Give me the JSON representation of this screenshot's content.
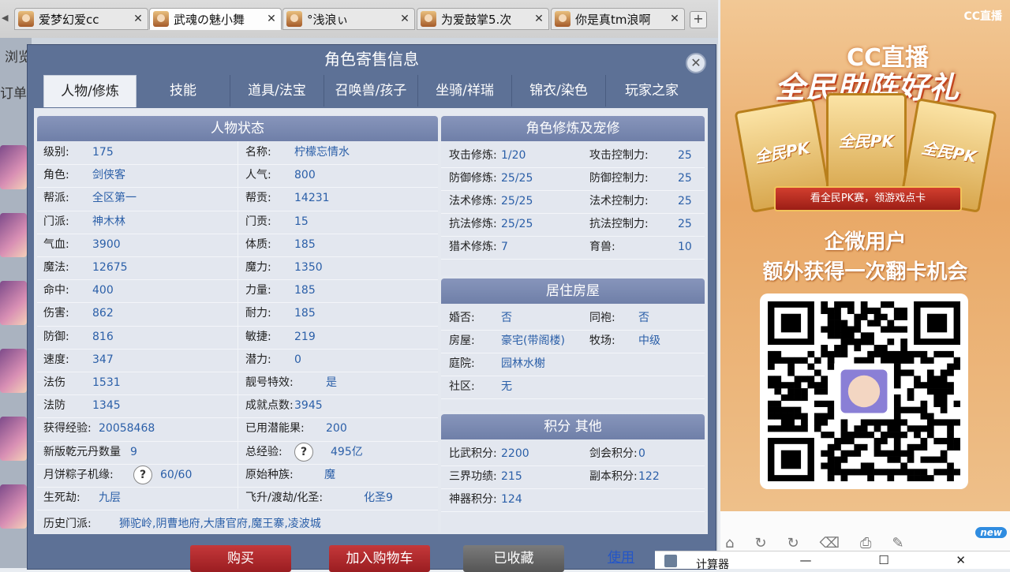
{
  "browser": {
    "tabs": [
      {
        "title": "爱梦幻爱cc",
        "close": "✕"
      },
      {
        "title": "武魂の魅小舞",
        "close": "✕"
      },
      {
        "title": "°浅浪ぃ",
        "close": "✕"
      },
      {
        "title": "为爱鼓掌5.次",
        "close": "✕"
      },
      {
        "title": "你是真tm浪啊",
        "close": "✕"
      }
    ],
    "add_tab": "+",
    "behind_text_1": "浏览",
    "behind_text_2": "订单"
  },
  "dialog": {
    "title": "角色寄售信息",
    "close": "✕",
    "tabs": [
      "人物/修炼",
      "技能",
      "道具/法宝",
      "召唤兽/孩子",
      "坐骑/祥瑞",
      "锦衣/染色",
      "玩家之家"
    ],
    "active_tab": "人物/修炼"
  },
  "status": {
    "header": "人物状态",
    "left": [
      {
        "label": "级别:",
        "value": "175"
      },
      {
        "label": "角色:",
        "value": "剑侠客"
      },
      {
        "label": "帮派:",
        "value": "全区第一"
      },
      {
        "label": "门派:",
        "value": "神木林"
      },
      {
        "label": "气血:",
        "value": "3900"
      },
      {
        "label": "魔法:",
        "value": "12675"
      },
      {
        "label": "命中:",
        "value": "400"
      },
      {
        "label": "伤害:",
        "value": "862"
      },
      {
        "label": "防御:",
        "value": "816"
      },
      {
        "label": "速度:",
        "value": "347"
      },
      {
        "label": "法伤",
        "value": "1531"
      },
      {
        "label": "法防",
        "value": "1345"
      },
      {
        "label": "获得经验:",
        "value": "20058468"
      },
      {
        "label": "新版乾元丹数量",
        "value": "9"
      },
      {
        "label": "月饼粽子机缘:",
        "value": "60/60"
      },
      {
        "label": "生死劫:",
        "value": "九层"
      }
    ],
    "right": [
      {
        "label": "名称:",
        "value": "柠檬忘情水"
      },
      {
        "label": "人气:",
        "value": "800"
      },
      {
        "label": "帮贡:",
        "value": "14231"
      },
      {
        "label": "门贡:",
        "value": "15"
      },
      {
        "label": "体质:",
        "value": "185"
      },
      {
        "label": "魔力:",
        "value": "1350"
      },
      {
        "label": "力量:",
        "value": "185"
      },
      {
        "label": "耐力:",
        "value": "185"
      },
      {
        "label": "敏捷:",
        "value": "219"
      },
      {
        "label": "潜力:",
        "value": "0"
      },
      {
        "label": "靓号特效:",
        "value": "是"
      },
      {
        "label": "成就点数:",
        "value": "3945"
      },
      {
        "label": "已用潜能果:",
        "value": "200"
      },
      {
        "label": "总经验:",
        "value": "495亿"
      },
      {
        "label": "原始种族:",
        "value": "魔"
      },
      {
        "label": "飞升/渡劫/化圣:",
        "value": "化圣9"
      }
    ],
    "history_label": "历史门派:",
    "history_value": "狮驼岭,阴曹地府,大唐官府,魔王寨,凌波城",
    "help": "?"
  },
  "cultivation": {
    "header": "角色修炼及宠修",
    "rows": [
      {
        "l1": "攻击修炼:",
        "v1": "1/20",
        "l2": "攻击控制力:",
        "v2": "25"
      },
      {
        "l1": "防御修炼:",
        "v1": "25/25",
        "l2": "防御控制力:",
        "v2": "25"
      },
      {
        "l1": "法术修炼:",
        "v1": "25/25",
        "l2": "法术控制力:",
        "v2": "25"
      },
      {
        "l1": "抗法修炼:",
        "v1": "25/25",
        "l2": "抗法控制力:",
        "v2": "25"
      },
      {
        "l1": "猎术修炼:",
        "v1": "7",
        "l2": "育兽:",
        "v2": "10"
      }
    ]
  },
  "housing": {
    "header": "居住房屋",
    "rows": [
      {
        "l1": "婚否:",
        "v1": "否",
        "l2": "同袍:",
        "v2": "否"
      },
      {
        "l1": "房屋:",
        "v1": "豪宅(带阁楼)",
        "l2": "牧场:",
        "v2": "中级"
      },
      {
        "l1": "庭院:",
        "v1": "园林水榭",
        "l2": "",
        "v2": ""
      },
      {
        "l1": "社区:",
        "v1": "无",
        "l2": "",
        "v2": ""
      }
    ]
  },
  "points": {
    "header": "积分 其他",
    "rows": [
      {
        "l1": "比武积分:",
        "v1": "2200",
        "l2": "剑会积分:",
        "v2": "0"
      },
      {
        "l1": "三界功绩:",
        "v1": "215",
        "l2": "副本积分:",
        "v2": "122"
      },
      {
        "l1": "神器积分:",
        "v1": "124",
        "l2": "",
        "v2": ""
      }
    ]
  },
  "actions": {
    "buy": "购买",
    "add_cart": "加入购物车",
    "favorited": "已收藏",
    "link": "使用"
  },
  "ad": {
    "brand": "CC直播",
    "brand_big": "CC直播",
    "headline": "全民助阵好礼",
    "card_text": "全民PK",
    "ribbon": "看全民PK赛，领游戏点卡",
    "line1": "企微用户",
    "line2": "额外获得一次翻卡机会",
    "badge": "new"
  },
  "taskbar": {
    "calculator": "计算器",
    "controls": "— ☐ ✕"
  },
  "colors": {
    "dialog_bg": "#5d7196",
    "panel_header": "#7b89b0",
    "value_blue": "#2b5fa8",
    "buy_red": "#b3262a",
    "disabled_gray": "#6b6b6b"
  }
}
